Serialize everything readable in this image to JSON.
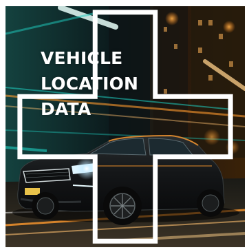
{
  "headline": {
    "lines": [
      "VEHICLE",
      "LOCATION",
      "DATA"
    ]
  },
  "icons": {
    "plus": "plus-outline-icon"
  },
  "colors": {
    "background_dark": "#0b1114",
    "teal_light": "#1fd0c2",
    "amber_light": "#ff9a2e",
    "headline_text": "#ffffff",
    "plus_outline": "#ffffff"
  }
}
